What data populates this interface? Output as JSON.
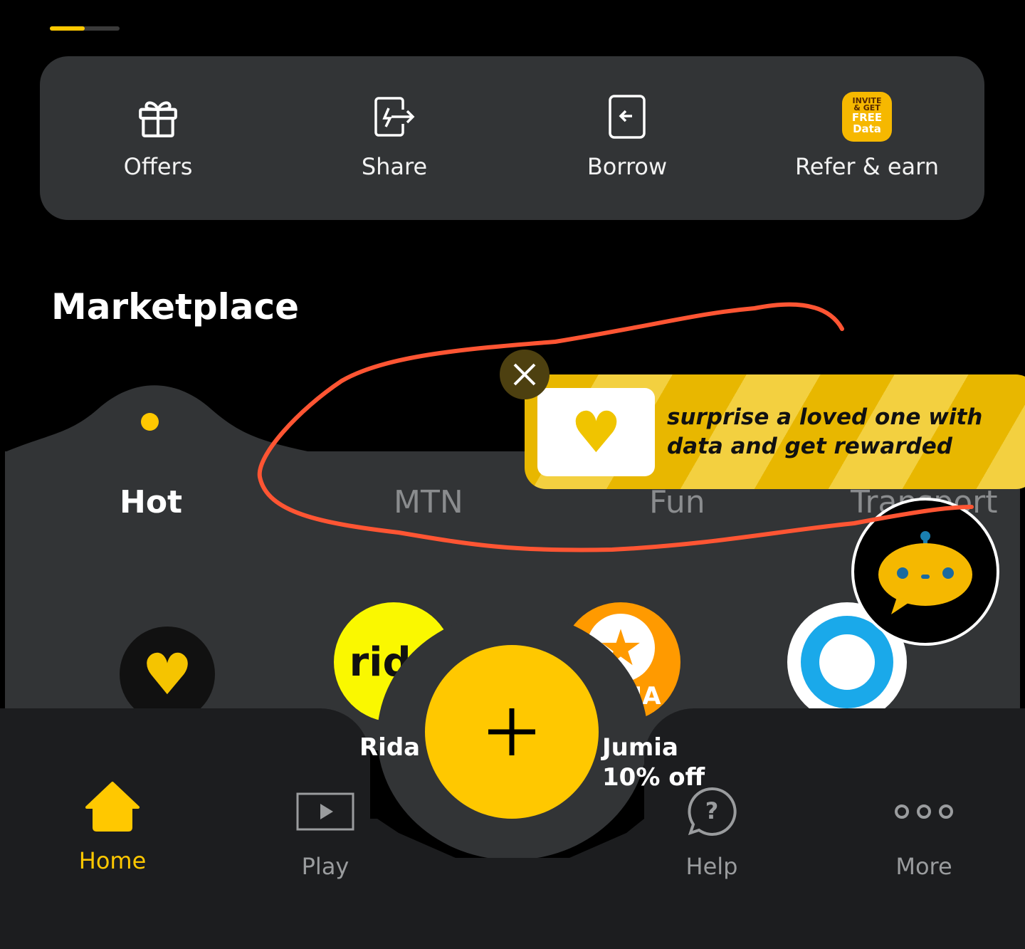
{
  "progress": {
    "value": 0.5,
    "color": "#ffc800"
  },
  "quick_actions": [
    {
      "label": "Offers",
      "icon": "gift-icon"
    },
    {
      "label": "Share",
      "icon": "share-icon"
    },
    {
      "label": "Borrow",
      "icon": "borrow-icon"
    },
    {
      "label": "Refer & earn",
      "icon": "invite-free-data-icon",
      "badge_text": [
        "INVITE",
        "& GET",
        "FREE",
        "Data"
      ]
    }
  ],
  "marketplace": {
    "title": "Marketplace",
    "tabs": [
      {
        "label": "Hot",
        "active": true
      },
      {
        "label": "MTN"
      },
      {
        "label": "Fun"
      },
      {
        "label": "Transport"
      }
    ],
    "items": [
      {
        "name": "",
        "icon": "gold-hearts-icon"
      },
      {
        "name": "Rida",
        "logo_text": "rida"
      },
      {
        "name": "Jumia",
        "logo_text": "JUMIA",
        "subtitle": "10% off"
      },
      {
        "name": "",
        "icon": "blue-ring-icon"
      }
    ]
  },
  "banner": {
    "text_line1": "surprise a loved one with",
    "text_line2": "data and get rewarded"
  },
  "nav": [
    {
      "label": "Home",
      "icon": "home-icon",
      "active": true
    },
    {
      "label": "Play",
      "icon": "play-icon"
    },
    {
      "label": "Help",
      "icon": "help-icon"
    },
    {
      "label": "More",
      "icon": "more-icon"
    }
  ],
  "colors": {
    "accent": "#ffc800",
    "annotation": "#ff5533"
  }
}
